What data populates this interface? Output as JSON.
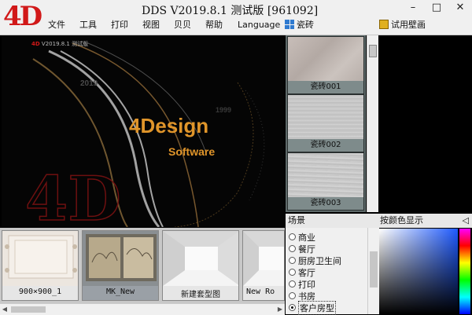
{
  "app": {
    "logo_text": "4D",
    "title": "DDS  V2019.8.1 测试版 [961092]"
  },
  "menu": {
    "items": [
      "文件",
      "工具",
      "打印",
      "视图",
      "贝贝",
      "帮助",
      "Language"
    ]
  },
  "toolbar": {
    "tile_label": "瓷砖",
    "wallpaper_label": "试用壁画"
  },
  "window_controls": {
    "minimize": "–",
    "maximize": "□",
    "close": "✕"
  },
  "splash": {
    "small_logo_brand": "4D",
    "small_logo_text": "V2019.8.1 测试版",
    "brand": "4Design",
    "brand_sub": "Software",
    "year_a": "2019",
    "year_b": "1999"
  },
  "tiles": [
    {
      "label": "瓷砖001"
    },
    {
      "label": "瓷砖002"
    },
    {
      "label": "瓷砖003"
    }
  ],
  "thumbnails": [
    {
      "label": "900×900_1"
    },
    {
      "label": "MK_New"
    },
    {
      "label": "新建套型图"
    },
    {
      "label": "New Ro"
    }
  ],
  "scene": {
    "title": "场景",
    "items": [
      {
        "label": "商业",
        "selected": false
      },
      {
        "label": "餐厅",
        "selected": false
      },
      {
        "label": "厨房卫生间",
        "selected": false
      },
      {
        "label": "客厅",
        "selected": false
      },
      {
        "label": "打印",
        "selected": false
      },
      {
        "label": "书房",
        "selected": false
      },
      {
        "label": "客户房型",
        "selected": true
      }
    ]
  },
  "color_panel": {
    "title": "按颜色显示",
    "collapse_icon": "◁"
  },
  "colors": {
    "accent_orange": "#e0952a",
    "logo_red": "#d11818"
  }
}
